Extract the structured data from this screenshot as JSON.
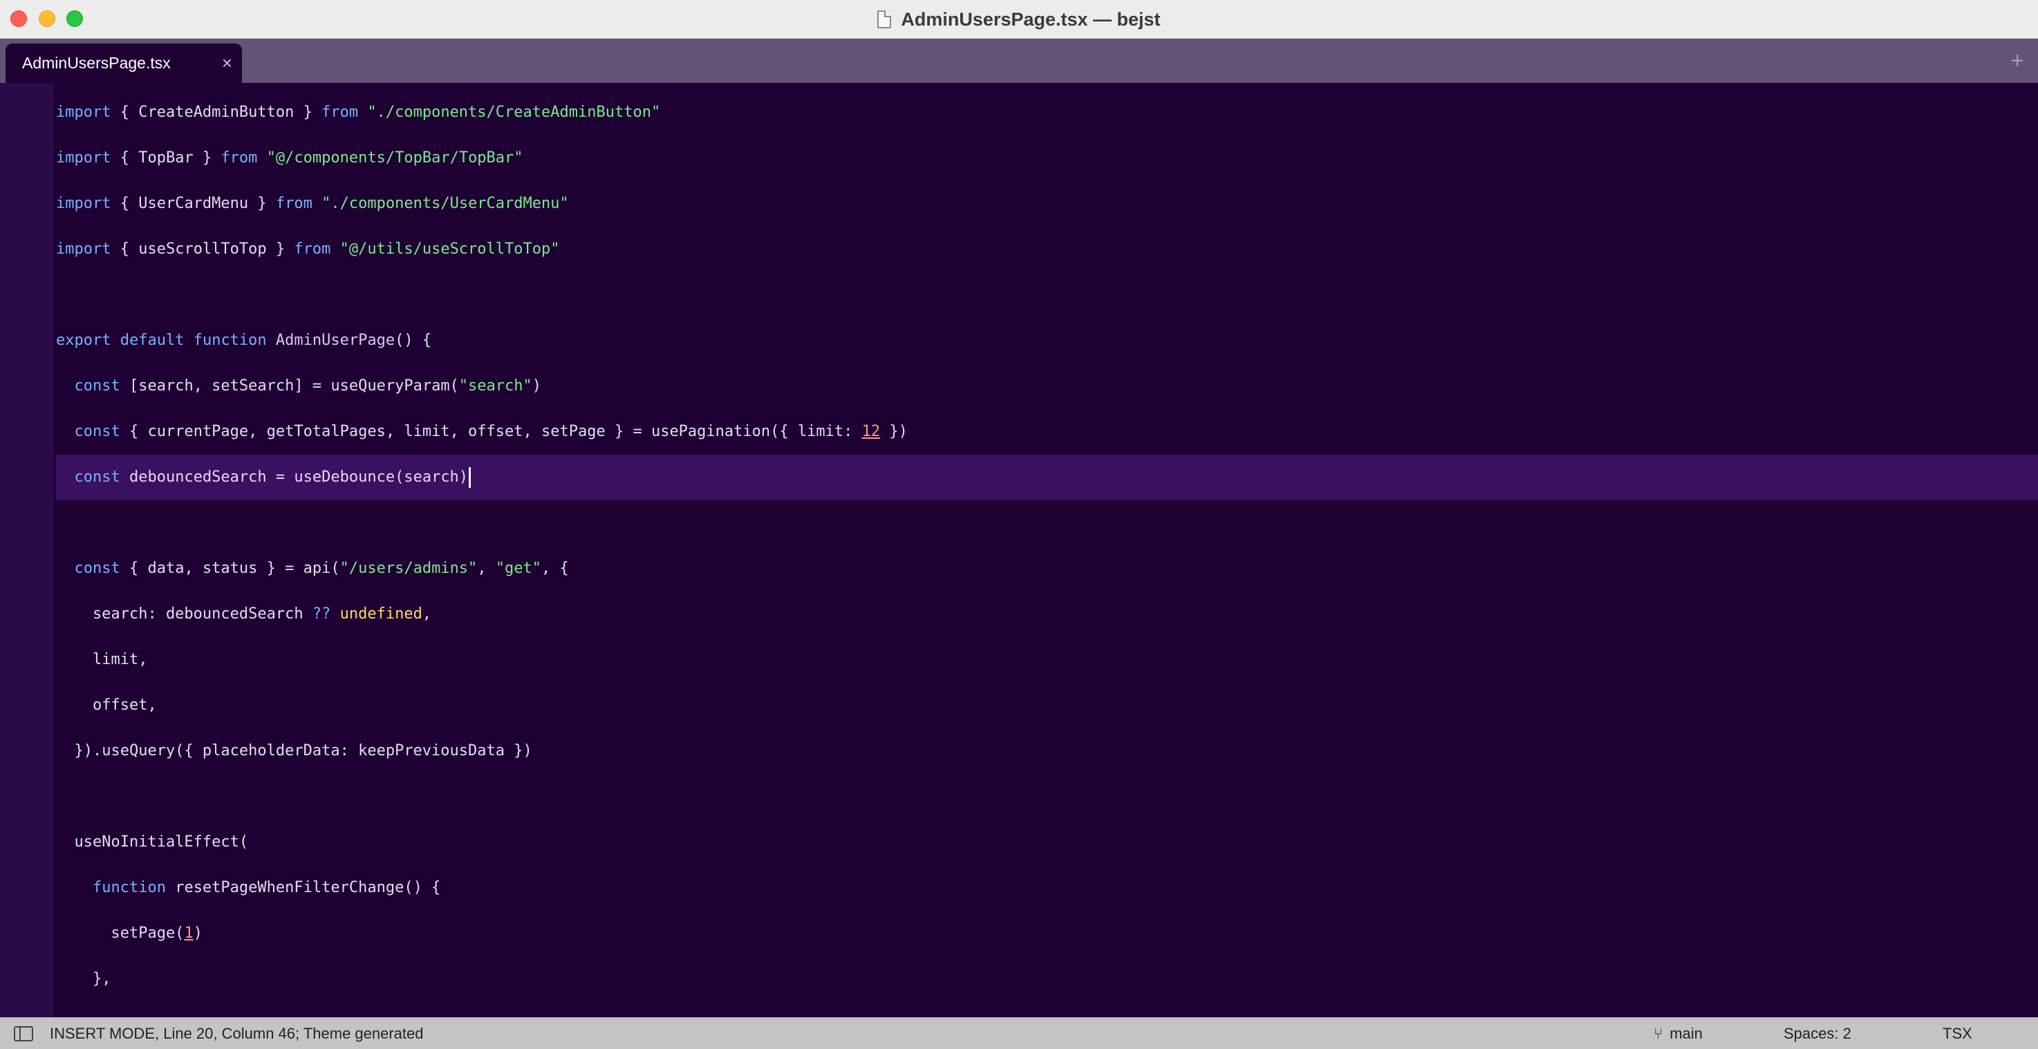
{
  "window": {
    "title": "AdminUsersPage.tsx — bejst"
  },
  "tabs": [
    {
      "label": "AdminUsersPage.tsx",
      "close": "×",
      "active": true
    }
  ],
  "tabbar": {
    "new_tab": "+"
  },
  "status": {
    "mode": "INSERT MODE, Line 20, Column 46; Theme generated",
    "branch": "main",
    "spaces": "Spaces: 2",
    "syntax": "TSX"
  },
  "code_lines": [
    "import { CreateAdminButton } from \"./components/CreateAdminButton\"",
    "import { TopBar } from \"@/components/TopBar/TopBar\"",
    "import { UserCardMenu } from \"./components/UserCardMenu\"",
    "import { useScrollToTop } from \"@/utils/useScrollToTop\"",
    "",
    "export default function AdminUserPage() {",
    "  const [search, setSearch] = useQueryParam(\"search\")",
    "  const { currentPage, getTotalPages, limit, offset, setPage } = usePagination({ limit: 12 })",
    "  const debouncedSearch = useDebounce(search)",
    "",
    "  const { data, status } = api(\"/users/admins\", \"get\", {",
    "    search: debouncedSearch ?? undefined,",
    "    limit,",
    "    offset,",
    "  }).useQuery({ placeholderData: keepPreviousData })",
    "",
    "  useNoInitialEffect(",
    "    function resetPageWhenFilterChange() {",
    "      setPage(1)",
    "    },"
  ],
  "active_line": 8,
  "colors": {
    "background": "#1e0033",
    "keyword": "#7ab0ff",
    "string": "#7ee88a",
    "number": "#ff9a7a",
    "constant": "#ffd966",
    "active_line": "#3a1060",
    "tab_bar": "#635476"
  }
}
